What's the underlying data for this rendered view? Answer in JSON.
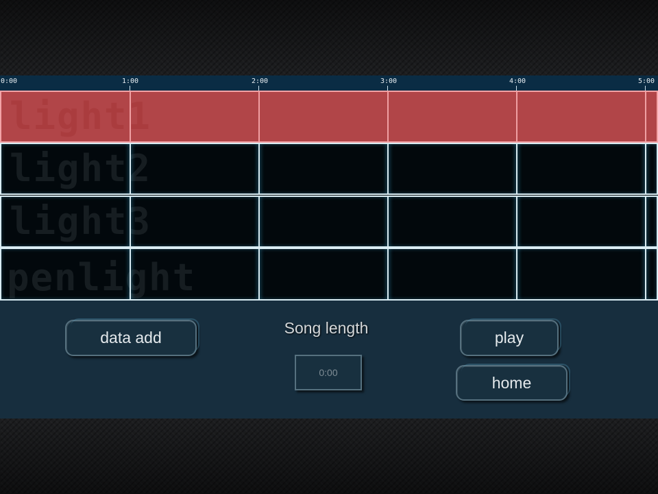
{
  "timeline": {
    "ticks": [
      "0:00",
      "1:00",
      "2:00",
      "3:00",
      "4:00",
      "5:00"
    ]
  },
  "tracks": [
    {
      "label": "light1",
      "selected": true
    },
    {
      "label": "light2",
      "selected": false
    },
    {
      "label": "light3",
      "selected": false
    },
    {
      "label": "penlight",
      "selected": false
    }
  ],
  "controls": {
    "data_add_label": "data add",
    "song_length_label": "Song length",
    "song_length_placeholder": "0:00",
    "play_label": "play",
    "home_label": "home"
  },
  "colors": {
    "selected_track": "#b14548",
    "header_bar": "#0a2c44",
    "panel": "#172e3e"
  }
}
